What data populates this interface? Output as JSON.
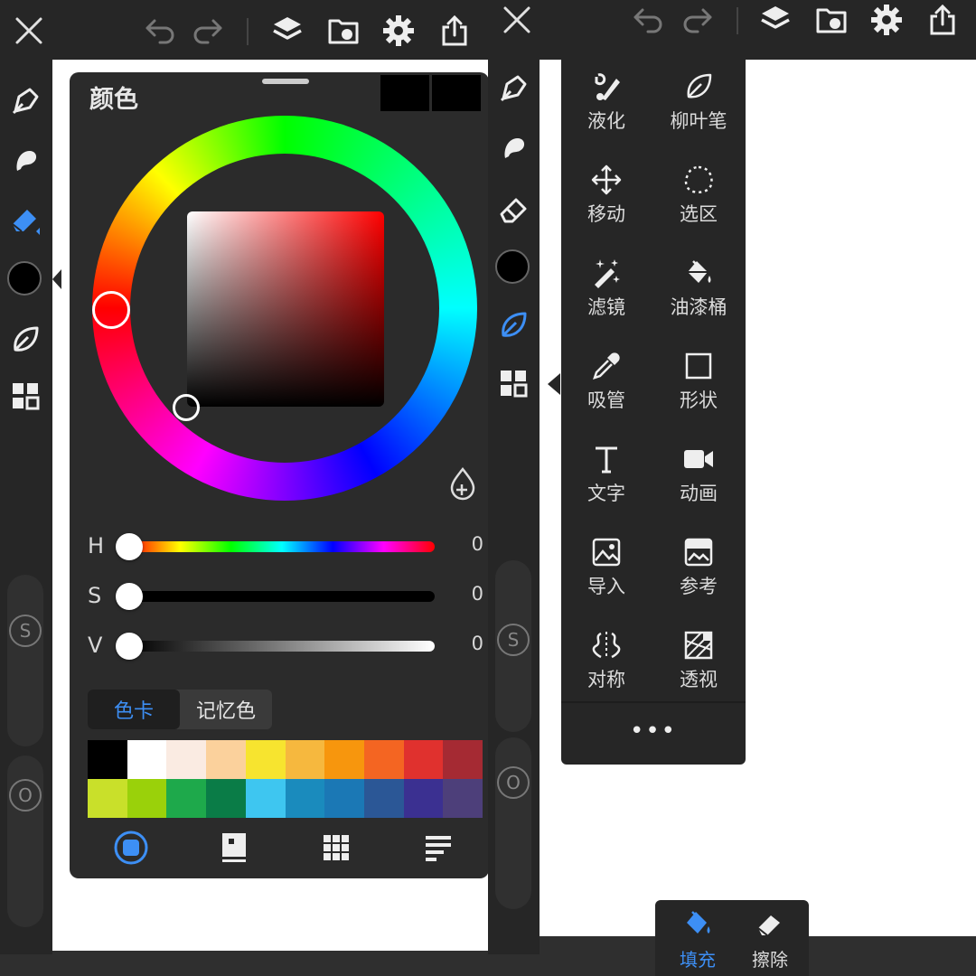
{
  "left": {
    "topbar": {
      "icons": [
        "close-icon",
        "undo-icon",
        "redo-icon",
        "layers-icon",
        "gallery-icon",
        "settings-icon",
        "share-icon"
      ]
    },
    "sidebar": {
      "round_labels": {
        "size": "S",
        "opacity": "O"
      }
    },
    "color_panel": {
      "title": "颜色",
      "selected_color": "#000000",
      "hue_ring_indicator_color": "#ff0000",
      "hsv": [
        {
          "label": "H",
          "value": "0"
        },
        {
          "label": "S",
          "value": "0"
        },
        {
          "label": "V",
          "value": "0"
        }
      ],
      "tabs": {
        "card": "色卡",
        "history": "记忆色",
        "active": "色卡"
      },
      "palette": [
        "#000000",
        "#ffffff",
        "#faebe2",
        "#fbd19c",
        "#f7e42f",
        "#f6b83e",
        "#f7960d",
        "#f46522",
        "#e0312e",
        "#a52a33",
        "#c9e02a",
        "#9ad10a",
        "#1ea94b",
        "#0a7c47",
        "#3ec6f0",
        "#1a8bbd",
        "#1b78b5",
        "#2b5796",
        "#3b3091",
        "#4d3f7a"
      ],
      "bottom_tabs": [
        "color-wheel-icon",
        "palette-card-icon",
        "grid-icon",
        "list-icon"
      ]
    }
  },
  "right": {
    "tools": [
      {
        "label": "液化",
        "icon": "liquify-icon"
      },
      {
        "label": "柳叶笔",
        "icon": "leaf-pen-icon"
      },
      {
        "label": "移动",
        "icon": "move-icon"
      },
      {
        "label": "选区",
        "icon": "lasso-icon"
      },
      {
        "label": "滤镜",
        "icon": "magic-wand-icon"
      },
      {
        "label": "油漆桶",
        "icon": "paint-bucket-icon"
      },
      {
        "label": "吸管",
        "icon": "eyedropper-icon"
      },
      {
        "label": "形状",
        "icon": "square-icon"
      },
      {
        "label": "文字",
        "icon": "text-icon"
      },
      {
        "label": "动画",
        "icon": "video-icon"
      },
      {
        "label": "导入",
        "icon": "import-image-icon"
      },
      {
        "label": "参考",
        "icon": "reference-icon"
      },
      {
        "label": "对称",
        "icon": "symmetry-icon"
      },
      {
        "label": "透视",
        "icon": "perspective-icon"
      }
    ],
    "more": "•••",
    "fill_bar": [
      {
        "label": "填充",
        "active": true
      },
      {
        "label": "擦除",
        "active": false
      }
    ],
    "sidebar": {
      "round_labels": {
        "size": "S",
        "opacity": "O"
      }
    }
  },
  "colors": {
    "accent": "#3d8ff5",
    "panel": "#2b2b2b",
    "bar": "#262626"
  }
}
